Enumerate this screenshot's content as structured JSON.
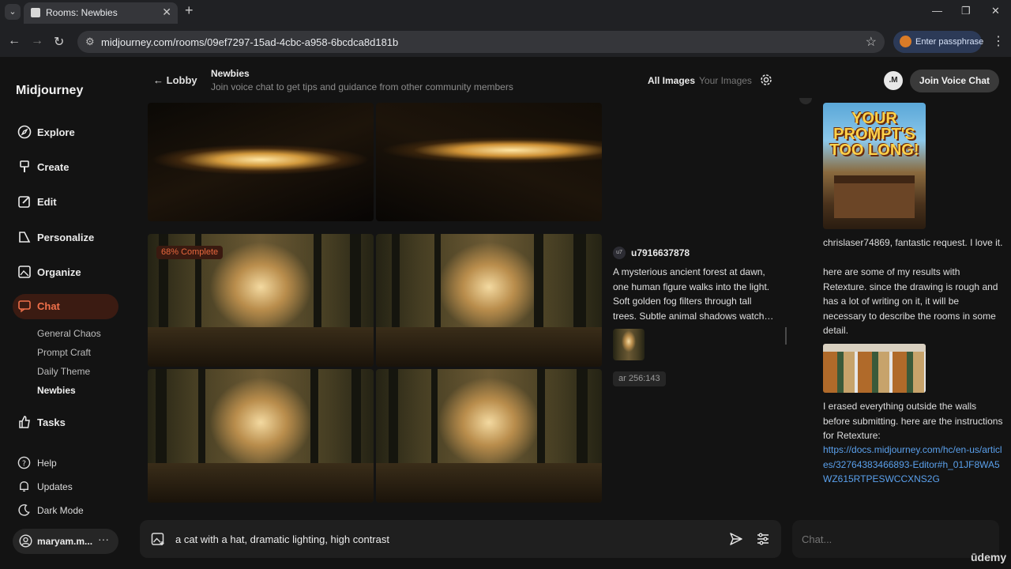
{
  "browser": {
    "tab_title": "Rooms: Newbies",
    "url": "midjourney.com/rooms/09ef7297-15ad-4cbc-a958-6bcdca8d181b",
    "passphrase_label": "Enter passphrase"
  },
  "sidebar": {
    "logo": "Midjourney",
    "items": [
      {
        "label": "Explore",
        "icon": "compass-icon"
      },
      {
        "label": "Create",
        "icon": "brush-icon"
      },
      {
        "label": "Edit",
        "icon": "edit-icon"
      },
      {
        "label": "Personalize",
        "icon": "personalize-icon"
      },
      {
        "label": "Organize",
        "icon": "image-icon"
      },
      {
        "label": "Chat",
        "icon": "chat-icon"
      }
    ],
    "chat_rooms": [
      "General Chaos",
      "Prompt Craft",
      "Daily Theme",
      "Newbies"
    ],
    "tasks_label": "Tasks",
    "bottom_items": [
      {
        "label": "Help",
        "icon": "help-icon"
      },
      {
        "label": "Updates",
        "icon": "bell-icon"
      },
      {
        "label": "Dark Mode",
        "icon": "moon-icon"
      }
    ],
    "user_name": "maryam.m..."
  },
  "header": {
    "back_label": "Lobby",
    "room_name": "Newbies",
    "room_description": "Join voice chat to get tips and guidance from other community members",
    "filter_all": "All Images",
    "filter_yours": "Your Images",
    "avatar_initials": ".M",
    "join_voice_label": "Join Voice Chat"
  },
  "feed": {
    "progress_label": "68% Complete",
    "author_badge": "u7",
    "author_name": "u7916637878",
    "prompt": "A mysterious ancient forest at dawn, one human figure walks into the light. Soft golden fog filters through tall trees. Subtle animal shadows watch…",
    "param_chip": "ar 256:143"
  },
  "right_panel": {
    "poster_text": "YOUR PROMPT'S TOO LONG!",
    "message_1": "chrislaser74869, fantastic request. I love it.",
    "message_2": "here are some of my results with Retexture. since the drawing is rough and has a lot of writing on it, it will be necessary to describe the rooms in some detail.",
    "message_3": "I erased everything outside the walls before submitting. here are the instructions for Retexture:",
    "link": "https://docs.midjourney.com/hc/en-us/articles/32764383466893-Editor#h_01JF8WA5WZ615RTPESWCCXNS2G"
  },
  "composer": {
    "prompt_value": "a cat with a hat, dramatic lighting, high contrast",
    "chat_placeholder": "Chat..."
  },
  "watermark": "ūdemy"
}
